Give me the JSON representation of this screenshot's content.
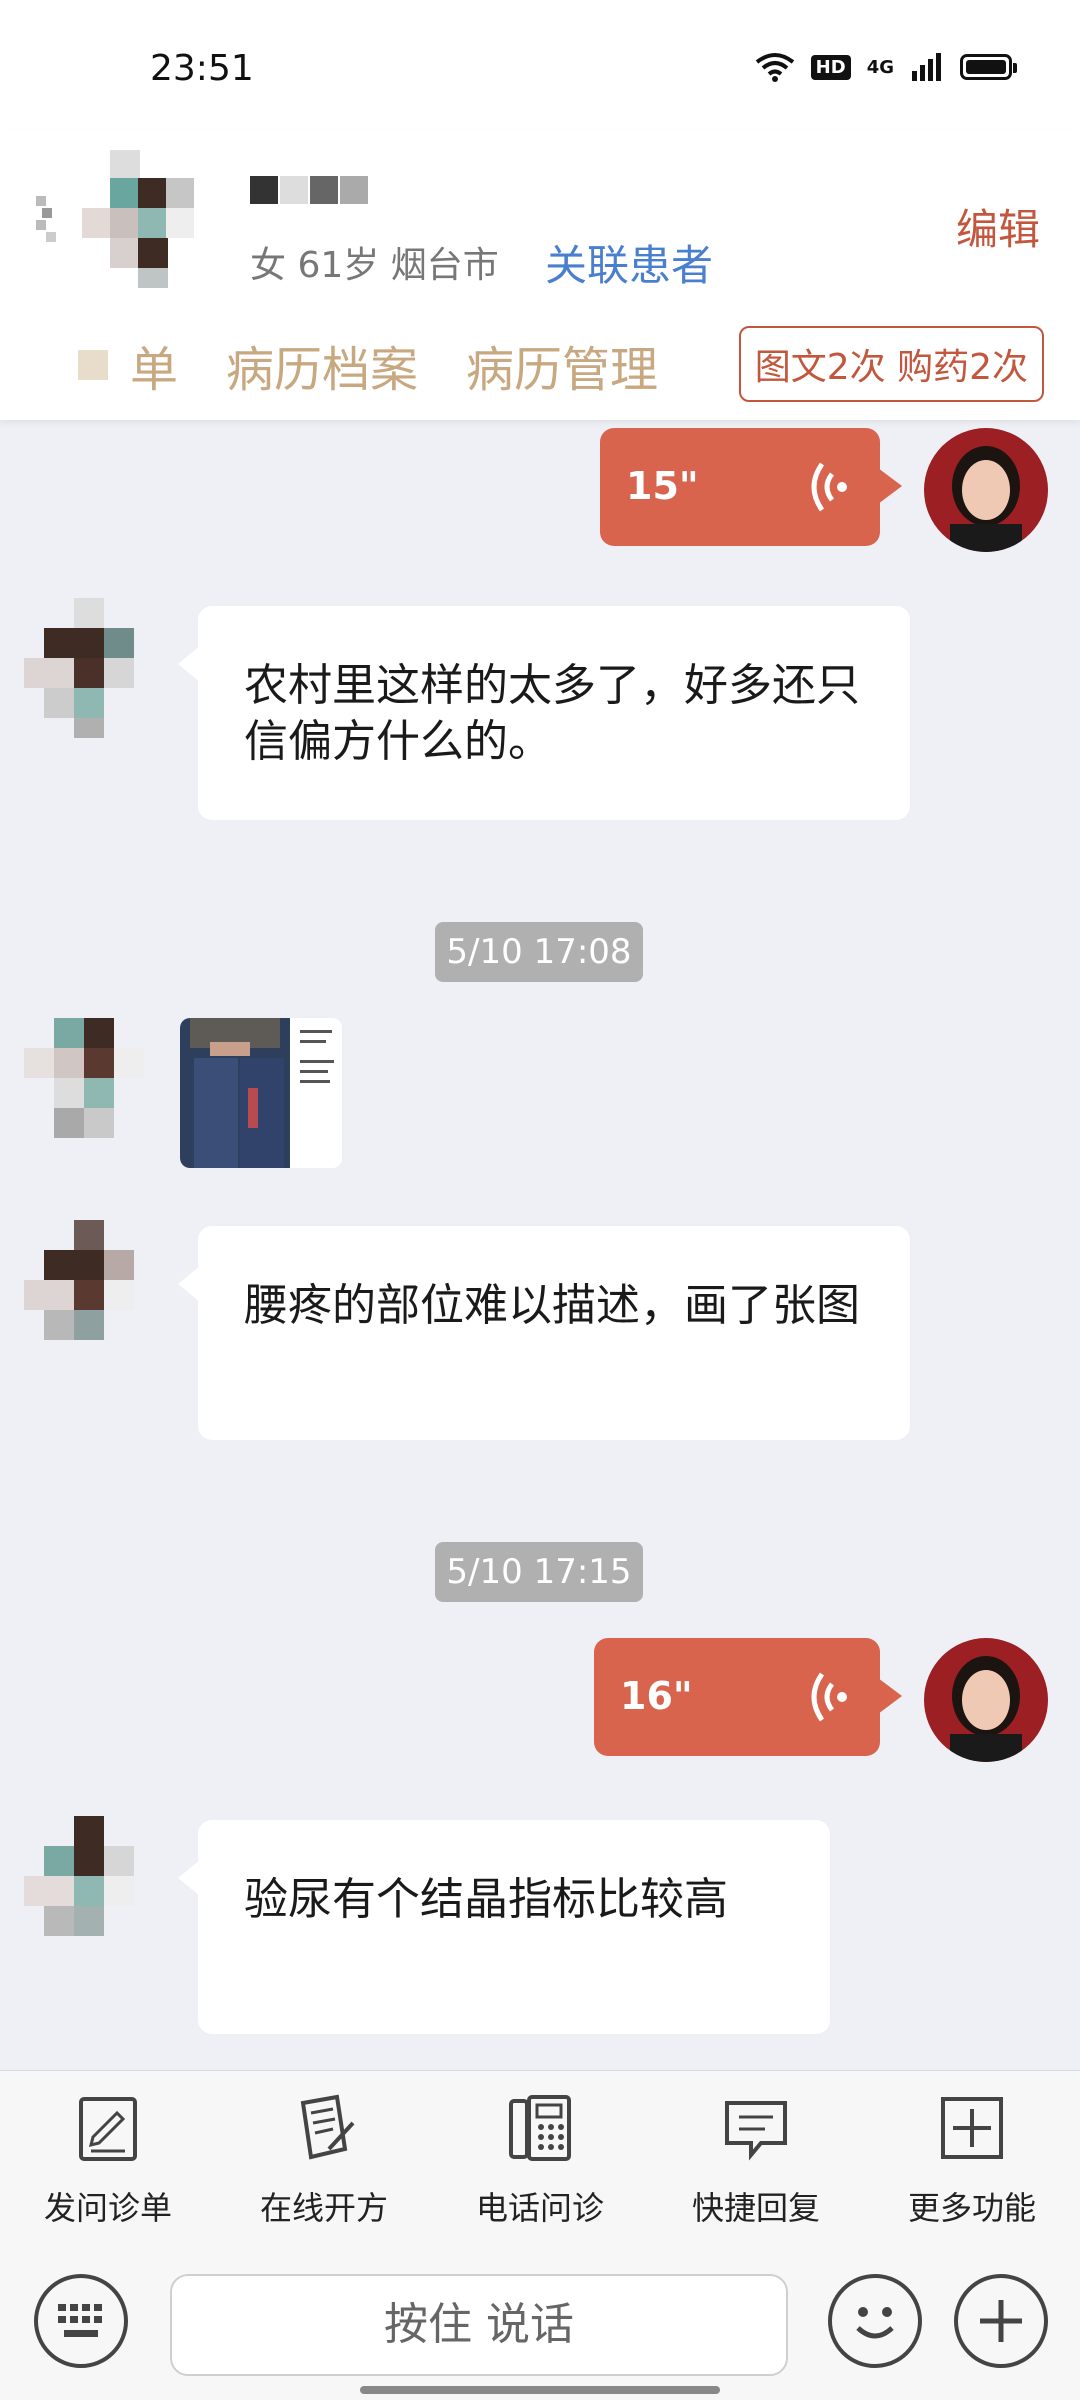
{
  "status_bar": {
    "time": "23:51",
    "hd_label": "HD",
    "network_label": "4G"
  },
  "header": {
    "patient_meta": "女 61岁  烟台市",
    "link_patient_label": "关联患者",
    "edit_label": "编辑",
    "tabs": [
      "单",
      "病历档案",
      "病历管理"
    ],
    "quota_badge": "图文2次 购药2次"
  },
  "messages": [
    {
      "type": "voice",
      "side": "right",
      "duration": "15\""
    },
    {
      "type": "text",
      "side": "left",
      "text": "农村里这样的太多了，好多还只信偏方什么的。"
    },
    {
      "type": "time",
      "text": "5/10 17:08"
    },
    {
      "type": "image",
      "side": "left"
    },
    {
      "type": "text",
      "side": "left",
      "text": "腰疼的部位难以描述，画了张图"
    },
    {
      "type": "time",
      "text": "5/10 17:15"
    },
    {
      "type": "voice",
      "side": "right",
      "duration": "16\""
    },
    {
      "type": "text",
      "side": "left",
      "text": "验尿有个结晶指标比较高"
    }
  ],
  "toolbar": {
    "items": [
      {
        "label": "发问诊单",
        "icon": "form-edit-icon"
      },
      {
        "label": "在线开方",
        "icon": "prescription-icon"
      },
      {
        "label": "电话问诊",
        "icon": "phone-icon"
      },
      {
        "label": "快捷回复",
        "icon": "quick-reply-icon"
      },
      {
        "label": "更多功能",
        "icon": "plus-square-icon"
      }
    ]
  },
  "input_bar": {
    "hold_to_talk": "按住 说话"
  },
  "colors": {
    "accent": "#d9644d",
    "link": "#4a7fd0",
    "tab": "#c8a880"
  }
}
